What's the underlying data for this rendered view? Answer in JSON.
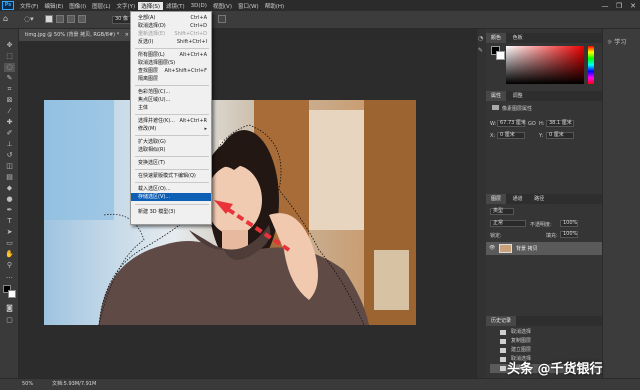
{
  "menubar": {
    "logo": "Ps",
    "items": [
      "文件(F)",
      "编辑(E)",
      "图像(I)",
      "图层(L)",
      "文字(Y)",
      "选择(S)",
      "滤镜(T)",
      "3D(D)",
      "视图(V)",
      "窗口(W)",
      "帮助(H)"
    ],
    "active_index": 5,
    "window_controls": [
      "—",
      "❐",
      "✕"
    ]
  },
  "options": {
    "feather_value": "30 像"
  },
  "document": {
    "tab_label": "timg.jpg @ 50% (背景 拷贝, RGB/8#) *",
    "tab_close": "×"
  },
  "select_menu": {
    "items": [
      {
        "label": "全部(A)",
        "shortcut": "Ctrl+A",
        "disabled": false
      },
      {
        "label": "取消选择(D)",
        "shortcut": "Ctrl+D",
        "disabled": false
      },
      {
        "label": "重新选择(E)",
        "shortcut": "Shift+Ctrl+D",
        "disabled": true
      },
      {
        "label": "反选(I)",
        "shortcut": "Shift+Ctrl+I",
        "disabled": false
      },
      {
        "label": "所有图层(L)",
        "shortcut": "Alt+Ctrl+A",
        "disabled": false
      },
      {
        "label": "取消选择图层(S)",
        "shortcut": "",
        "disabled": false
      },
      {
        "label": "查找图层",
        "shortcut": "Alt+Shift+Ctrl+F",
        "disabled": false
      },
      {
        "label": "隔离图层",
        "shortcut": "",
        "disabled": false
      },
      {
        "label": "色彩范围(C)...",
        "shortcut": "",
        "disabled": false
      },
      {
        "label": "焦点区域(U)...",
        "shortcut": "",
        "disabled": false
      },
      {
        "label": "主体",
        "shortcut": "",
        "disabled": false
      },
      {
        "label": "选择并遮住(K)...",
        "shortcut": "Alt+Ctrl+R",
        "disabled": false
      },
      {
        "label": "修改(M)",
        "shortcut": "▸",
        "disabled": false
      },
      {
        "label": "扩大选取(G)",
        "shortcut": "",
        "disabled": false
      },
      {
        "label": "选取相似(R)",
        "shortcut": "",
        "disabled": false
      },
      {
        "label": "变换选区(T)",
        "shortcut": "",
        "disabled": false
      },
      {
        "label": "在快速蒙版模式下编辑(Q)",
        "shortcut": "",
        "disabled": false
      },
      {
        "label": "载入选区(O)...",
        "shortcut": "",
        "disabled": false
      },
      {
        "label": "存储选区(V)...",
        "shortcut": "",
        "disabled": false,
        "highlighted": true
      },
      {
        "label": "新建 3D 模型(3)",
        "shortcut": "",
        "disabled": false
      }
    ]
  },
  "color_panel": {
    "tabs": [
      "颜色",
      "色板"
    ]
  },
  "properties_panel": {
    "tabs": [
      "属性",
      "调整"
    ],
    "title": "像素图层属性",
    "w_label": "W:",
    "w_value": "67.73 厘米",
    "go_label": "GO",
    "h_label": "H:",
    "h_value": "38.1 厘米",
    "x_label": "X:",
    "x_value": "0 厘米",
    "y_label": "Y:",
    "y_value": "0 厘米"
  },
  "layers_panel": {
    "tabs": [
      "图层",
      "通道",
      "路径"
    ],
    "filter": "类型",
    "blend_mode": "正常",
    "opacity_label": "不透明度:",
    "opacity": "100%",
    "lock_label": "锁定:",
    "fill_label": "填充:",
    "fill": "100%",
    "layers": [
      {
        "name": "背景 拷贝",
        "visible_icon": "👁"
      }
    ]
  },
  "history_panel": {
    "title": "历史记录",
    "items": [
      "取消选择",
      "复制图层",
      "建立图层",
      "取消选择",
      "存储选区"
    ]
  },
  "learn_panel": {
    "label": "学习"
  },
  "status": {
    "zoom": "50%",
    "doc": "文档:5.93M/7.91M"
  },
  "watermark": {
    "text": "头条 @千货银行"
  },
  "colors": {
    "accent": "#0d5fb5",
    "arrow": "#e8333a"
  }
}
